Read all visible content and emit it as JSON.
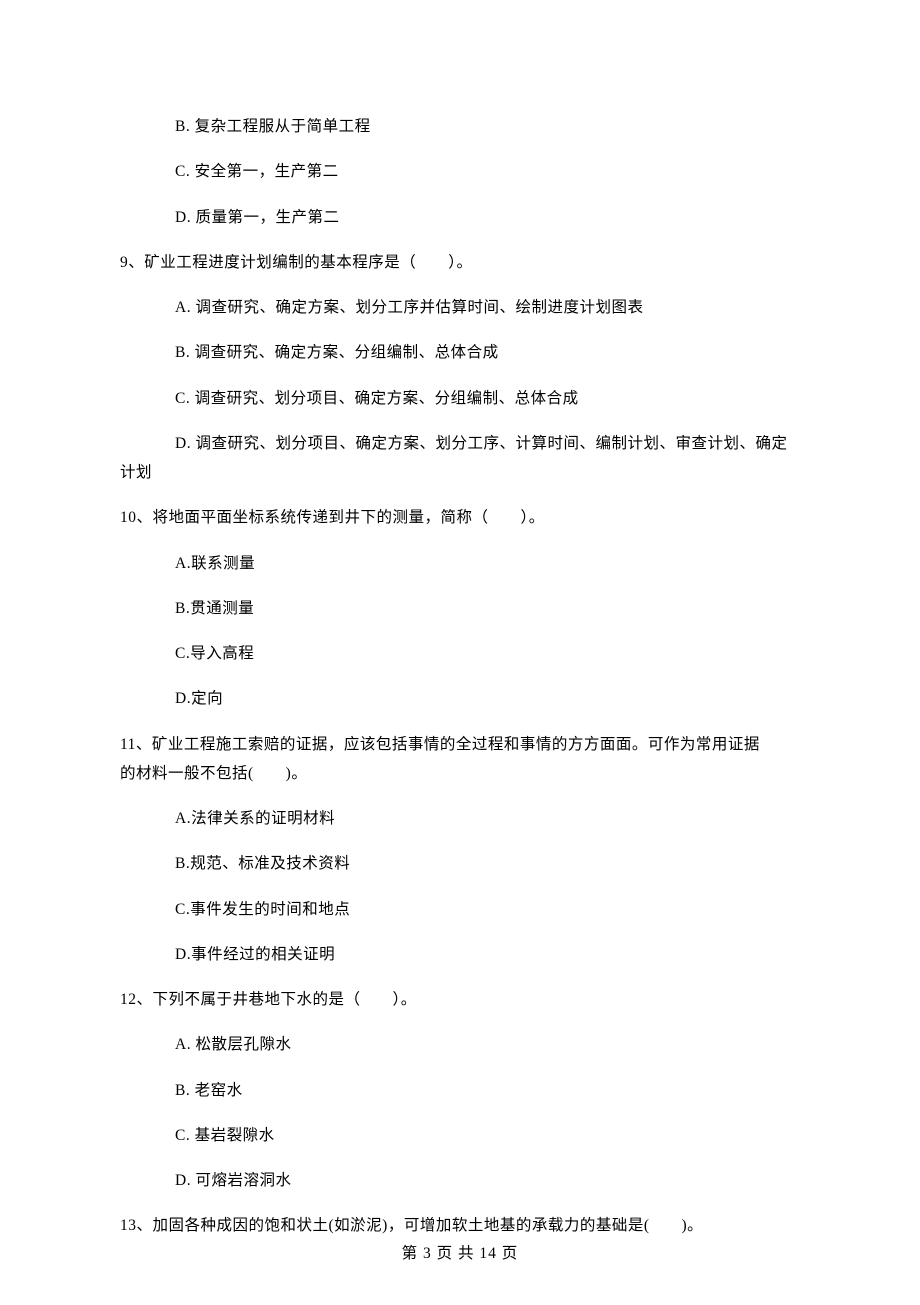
{
  "q8": {
    "optB": "B.  复杂工程服从于简单工程",
    "optC": "C.  安全第一，生产第二",
    "optD": "D.  质量第一，生产第二"
  },
  "q9": {
    "stem": "9、矿业工程进度计划编制的基本程序是（　　）。",
    "optA": "A.  调查研究、确定方案、划分工序并估算时间、绘制进度计划图表",
    "optB": "B.  调查研究、确定方案、分组编制、总体合成",
    "optC": "C.  调查研究、划分项目、确定方案、分组编制、总体合成",
    "optD_first": "D.  调查研究、划分项目、确定方案、划分工序、计算时间、编制计划、审查计划、确定",
    "optD_rest": "计划"
  },
  "q10": {
    "stem": "10、将地面平面坐标系统传递到井下的测量，简称（　　）。",
    "optA": "A.联系测量",
    "optB": "B.贯通测量",
    "optC": "C.导入高程",
    "optD": "D.定向"
  },
  "q11": {
    "stem_line1": "11、矿业工程施工索赔的证据，应该包括事情的全过程和事情的方方面面。可作为常用证据",
    "stem_line2": "的材料一般不包括(　　)。",
    "optA": "A.法律关系的证明材料",
    "optB": "B.规范、标准及技术资料",
    "optC": "C.事件发生的时间和地点",
    "optD": "D.事件经过的相关证明"
  },
  "q12": {
    "stem": "12、下列不属于井巷地下水的是（　　）。",
    "optA": "A.  松散层孔隙水",
    "optB": "B.  老窑水",
    "optC": "C.  基岩裂隙水",
    "optD": "D.  可熔岩溶洞水"
  },
  "q13": {
    "stem": "13、加固各种成因的饱和状土(如淤泥)，可增加软土地基的承载力的基础是(　　)。"
  },
  "footer": "第 3 页 共 14 页"
}
